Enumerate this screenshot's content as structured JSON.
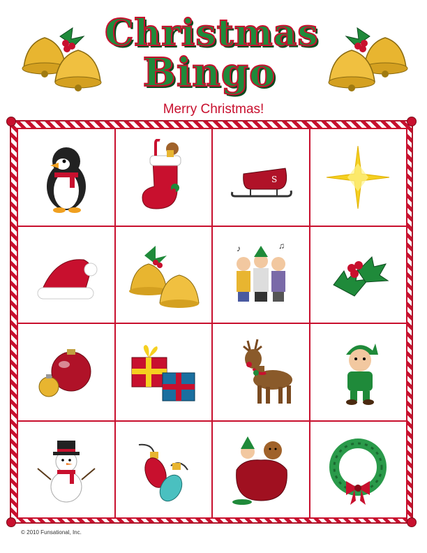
{
  "title": {
    "line1": "Christmas",
    "line2": "Bingo"
  },
  "subtitle": "Merry Christmas!",
  "copyright": "© 2010 Funsational, Inc.",
  "colors": {
    "red": "#c8102e",
    "green": "#1f8a3a",
    "gold": "#e8b530"
  },
  "cells": [
    "penguin-icon",
    "stocking-icon",
    "sleigh-icon",
    "star-icon",
    "santa-hat-icon",
    "bells-icon",
    "carolers-icon",
    "holly-icon",
    "ornament-icon",
    "presents-icon",
    "reindeer-icon",
    "elf-icon",
    "snowman-icon",
    "lights-icon",
    "toy-sack-icon",
    "wreath-icon"
  ]
}
